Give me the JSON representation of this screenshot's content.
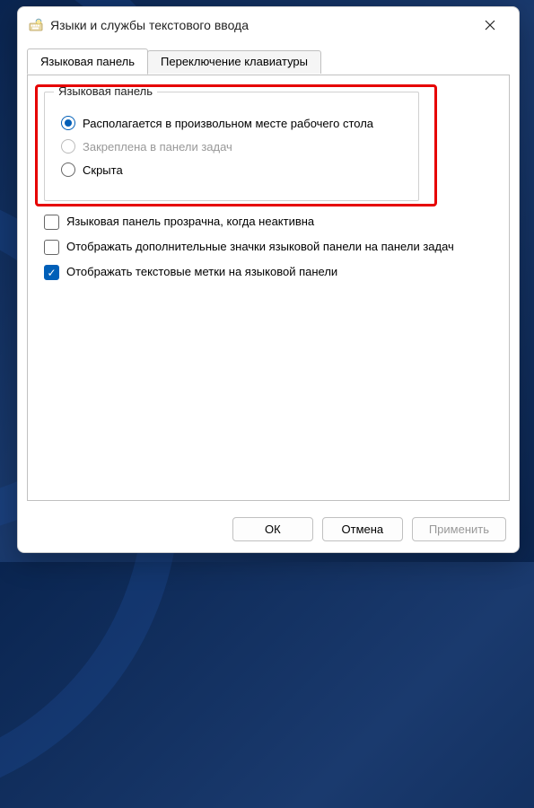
{
  "window": {
    "title": "Языки и службы текстового ввода"
  },
  "tabs": {
    "language_bar": "Языковая панель",
    "keyboard_switch": "Переключение клавиатуры"
  },
  "group": {
    "title": "Языковая панель",
    "options": {
      "floating": "Располагается в произвольном месте рабочего стола",
      "docked": "Закреплена в панели задач",
      "hidden": "Скрыта"
    }
  },
  "checkboxes": {
    "transparent": "Языковая панель прозрачна, когда неактивна",
    "extra_icons": "Отображать дополнительные значки языковой панели на панели задач",
    "text_labels": "Отображать текстовые метки на языковой панели"
  },
  "buttons": {
    "ok": "ОК",
    "cancel": "Отмена",
    "apply": "Применить"
  }
}
